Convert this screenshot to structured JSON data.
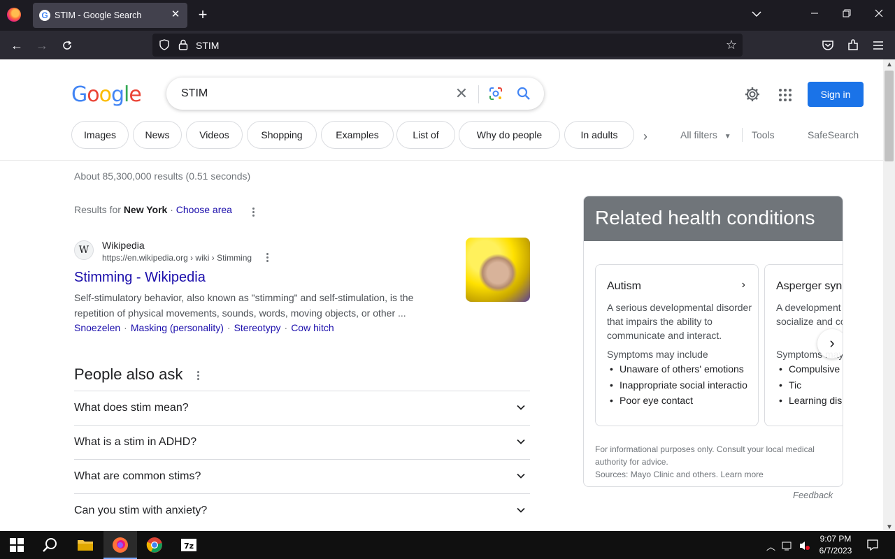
{
  "browser": {
    "tab_title": "STIM - Google Search",
    "url": "STIM"
  },
  "colors": {
    "link": "#1a0dab",
    "accent": "#1a73e8",
    "panel_header": "#70757a"
  },
  "header": {
    "logo": "Google",
    "search_query": "STIM",
    "sign_in": "Sign in"
  },
  "chips": [
    "Images",
    "News",
    "Videos",
    "Shopping",
    "Examples",
    "List of",
    "Why do people",
    "In adults"
  ],
  "filters": {
    "all_filters": "All filters",
    "tools": "Tools",
    "safesearch": "SafeSearch"
  },
  "results": {
    "stats": "About 85,300,000 results (0.51 seconds)",
    "location_prefix": "Results for",
    "location": "New York",
    "location_sep": " · ",
    "choose_area": "Choose area",
    "first": {
      "site": "Wikipedia",
      "url": "https://en.wikipedia.org › wiki › Stimming",
      "title": "Stimming - Wikipedia",
      "snippet": "Self-stimulatory behavior, also known as \"stimming\" and self-stimulation, is the repetition of physical movements, sounds, words, moving objects, or other ...",
      "sitelinks": [
        "Snoezelen",
        "Masking (personality)",
        "Stereotypy",
        "Cow hitch"
      ]
    }
  },
  "paa": {
    "title": "People also ask",
    "questions": [
      "What does stim mean?",
      "What is a stim in ADHD?",
      "What are common stims?",
      "Can you stim with anxiety?"
    ]
  },
  "knowledge_panel": {
    "title": "Related health conditions",
    "conditions": [
      {
        "name": "Autism",
        "desc": "A serious developmental disorder that impairs the ability to communicate and interact.",
        "symptoms_label": "Symptoms may include",
        "symptoms": [
          "Unaware of others' emotions",
          "Inappropriate social interactio",
          "Poor eye contact"
        ]
      },
      {
        "name": "Asperger syn",
        "desc": "A development affecting ability socialize and co",
        "symptoms_label": "Symptoms may",
        "symptoms": [
          "Compulsive",
          "Tic",
          "Learning dis"
        ]
      }
    ],
    "disclaimer": "For informational purposes only. Consult your local medical authority for advice.",
    "sources_prefix": "Sources: Mayo Clinic and others.",
    "learn_more": "Learn more",
    "feedback": "Feedback"
  },
  "taskbar": {
    "time": "9:07 PM",
    "date": "6/7/2023"
  }
}
